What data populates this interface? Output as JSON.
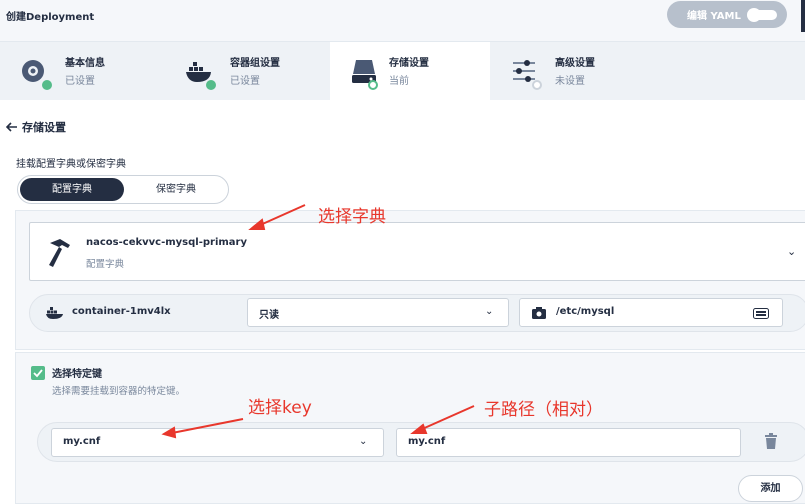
{
  "header": {
    "title": "创建Deployment",
    "yaml_button": "编辑 YAML"
  },
  "steps": [
    {
      "name": "基本信息",
      "status": "已设置",
      "icon": "info-disc-icon"
    },
    {
      "name": "容器组设置",
      "status": "已设置",
      "icon": "docker-whale-icon"
    },
    {
      "name": "存储设置",
      "status": "当前",
      "icon": "disk-drive-icon"
    },
    {
      "name": "高级设置",
      "status": "未设置",
      "icon": "sliders-icon"
    }
  ],
  "section": {
    "title": "存储设置"
  },
  "mount": {
    "label": "挂载配置字典或保密字典",
    "tabs": [
      "配置字典",
      "保密字典"
    ],
    "selected": {
      "name": "nacos-cekvvc-mysql-primary",
      "type": "配置字典"
    },
    "container": "container-1mv4lx",
    "access_mode": "只读",
    "mount_path": "/etc/mysql"
  },
  "keys": {
    "checkbox_label": "选择特定键",
    "description": "选择需要挂载到容器的特定键。",
    "key_value": "my.cnf",
    "sub_path": "my.cnf",
    "add_label": "添加"
  },
  "annotations": {
    "choose_dict": "选择字典",
    "choose_key": "选择key",
    "sub_path": "子路径（相对）"
  },
  "colors": {
    "accent": "#55bc8a",
    "dark": "#242e42",
    "annotation": "#e8372c"
  }
}
